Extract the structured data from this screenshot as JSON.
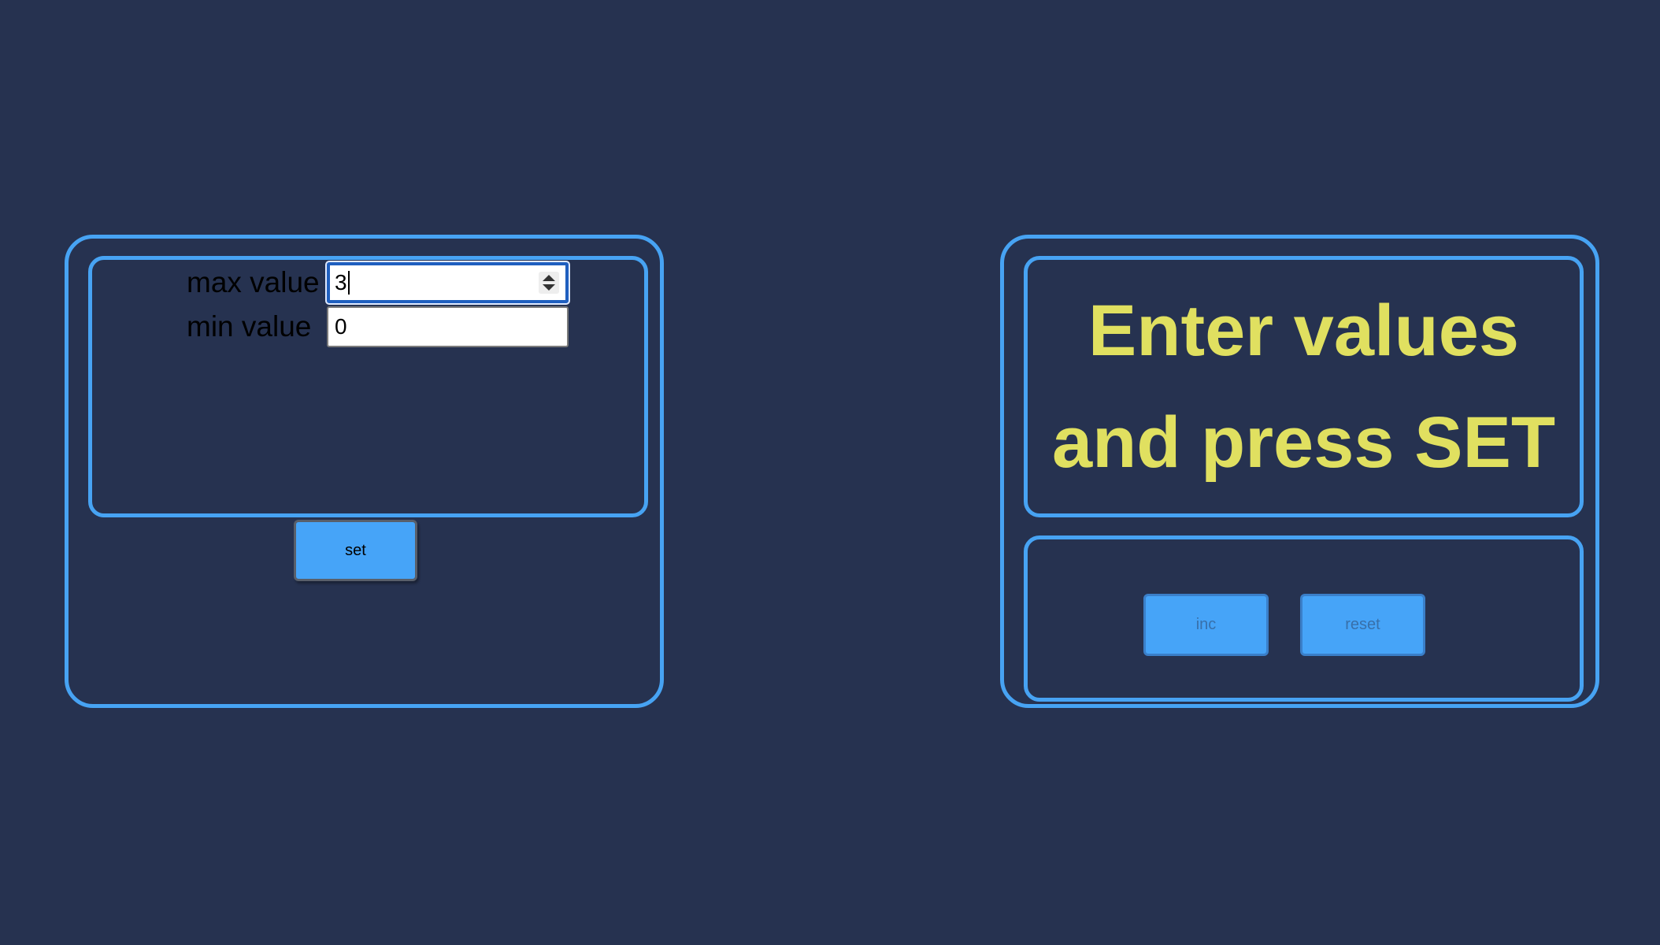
{
  "settings": {
    "max_label": "max value",
    "max_value": "3",
    "min_label": "min value",
    "min_value": "0",
    "set_label": "set"
  },
  "counter": {
    "message_line1": "Enter values",
    "message_line2": "and press SET",
    "inc_label": "inc",
    "reset_label": "reset"
  },
  "colors": {
    "background": "#263250",
    "border": "#47a3f3",
    "button": "#46a4f8",
    "message": "#e0e060"
  }
}
